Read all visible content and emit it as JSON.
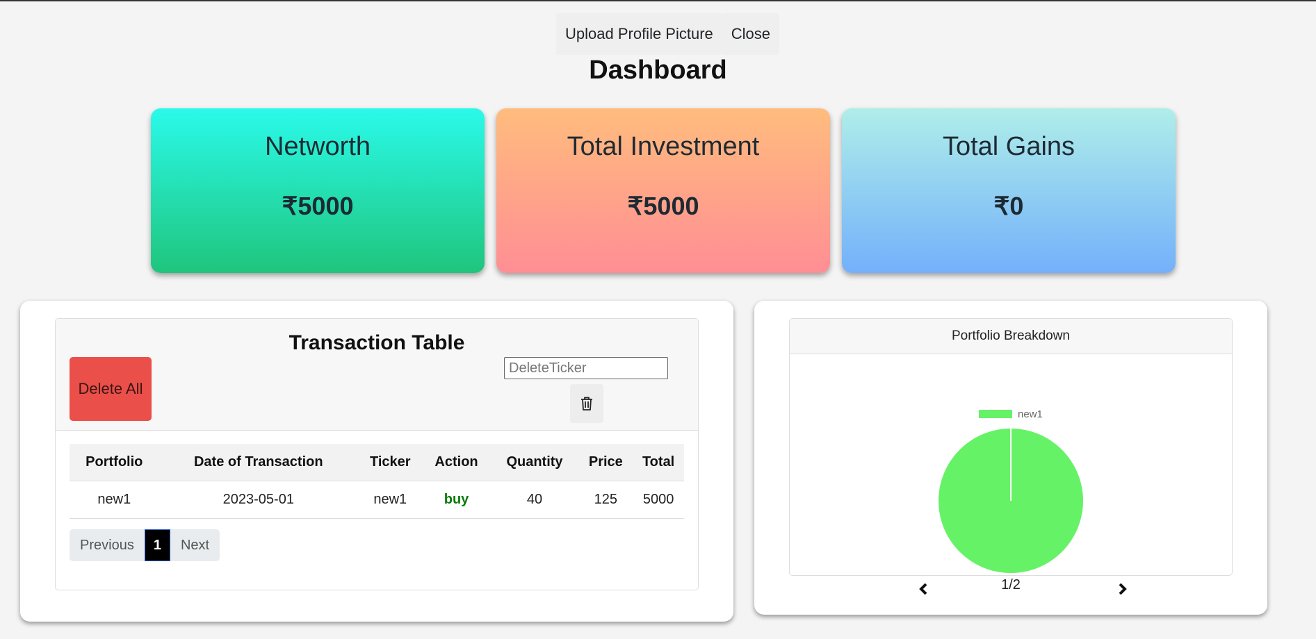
{
  "topbar": {
    "upload_label": "Upload Profile Picture",
    "close_label": "Close"
  },
  "page": {
    "title": "Dashboard"
  },
  "stats": {
    "networth": {
      "label": "Networth",
      "value": "₹5000"
    },
    "investment": {
      "label": "Total Investment",
      "value": "₹5000"
    },
    "gains": {
      "label": "Total Gains",
      "value": "₹0"
    }
  },
  "transactions": {
    "title": "Transaction Table",
    "delete_all_label": "Delete All",
    "delete_ticker_placeholder": "DeleteTicker",
    "trash_icon": "trash-icon",
    "columns": [
      "Portfolio",
      "Date of Transaction",
      "Ticker",
      "Action",
      "Quantity",
      "Price",
      "Total"
    ],
    "rows": [
      [
        "new1",
        "2023-05-01",
        "new1",
        "buy",
        "40",
        "125",
        "5000"
      ]
    ],
    "pagination": {
      "previous_label": "Previous",
      "current_page": "1",
      "next_label": "Next"
    }
  },
  "portfolio_chart": {
    "title": "Portfolio Breakdown",
    "page_indicator": "1/2",
    "prev_icon": "chevron-left-icon",
    "next_icon": "chevron-right-icon"
  },
  "chart_data": {
    "type": "pie",
    "title": "Portfolio Breakdown",
    "legend_position": "top",
    "slices": [
      {
        "label": "new1",
        "value": 5000,
        "color": "#66f266"
      }
    ]
  }
}
